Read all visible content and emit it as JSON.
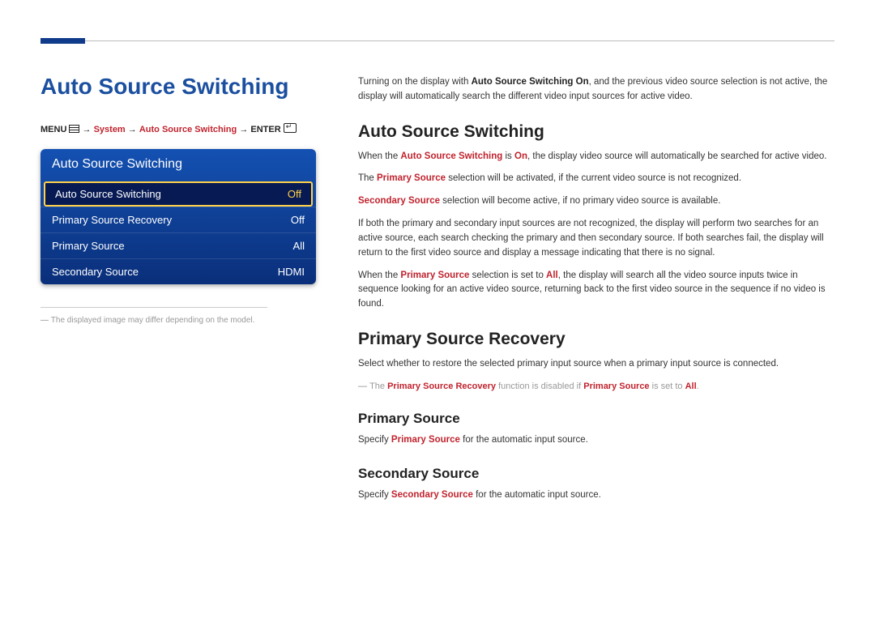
{
  "page": {
    "title": "Auto Source Switching"
  },
  "breadcrumb": {
    "menu": "MENU",
    "arrow": " → ",
    "p1": "System",
    "p2": "Auto Source Switching",
    "enter": "ENTER"
  },
  "osd": {
    "header": "Auto Source Switching",
    "rows": [
      {
        "label": "Auto Source Switching",
        "value": "Off"
      },
      {
        "label": "Primary Source Recovery",
        "value": "Off"
      },
      {
        "label": "Primary Source",
        "value": "All"
      },
      {
        "label": "Secondary Source",
        "value": "HDMI"
      }
    ]
  },
  "left_footnote": "The displayed image may differ depending on the model.",
  "intro": {
    "p1_a": "Turning on the display with ",
    "p1_b": "Auto Source Switching On",
    "p1_c": ", and the previous video source selection is not active, the display will automatically search the different video input sources for active video."
  },
  "sec1": {
    "h": "Auto Source Switching",
    "p1_a": "When the ",
    "p1_b": "Auto Source Switching",
    "p1_c": " is ",
    "p1_d": "On",
    "p1_e": ", the display video source will automatically be searched for active video.",
    "p2_a": "The ",
    "p2_b": "Primary Source",
    "p2_c": " selection will be activated, if the current video source is not recognized.",
    "p3_a": "Secondary Source",
    "p3_b": " selection will become active, if no primary video source is available.",
    "p4": "If both the primary and secondary input sources are not recognized, the display will perform two searches for an active source, each search checking the primary and then secondary source. If both searches fail, the display will return to the first video source and display a message indicating that there is no signal.",
    "p5_a": "When the ",
    "p5_b": "Primary Source",
    "p5_c": " selection is set to ",
    "p5_d": "All",
    "p5_e": ", the display will search all the video source inputs twice in sequence looking for an active video source, returning back to the first video source in the sequence if no video is found."
  },
  "sec2": {
    "h": "Primary Source Recovery",
    "p1": "Select whether to restore the selected primary input source when a primary input source is connected.",
    "note_a": "The ",
    "note_b": "Primary Source Recovery",
    "note_c": " function is disabled if ",
    "note_d": "Primary Source",
    "note_e": " is set to ",
    "note_f": "All",
    "note_g": "."
  },
  "sec3": {
    "h": "Primary Source",
    "p1_a": "Specify ",
    "p1_b": "Primary Source",
    "p1_c": " for the automatic input source."
  },
  "sec4": {
    "h": "Secondary Source",
    "p1_a": "Specify ",
    "p1_b": "Secondary Source",
    "p1_c": " for the automatic input source."
  }
}
